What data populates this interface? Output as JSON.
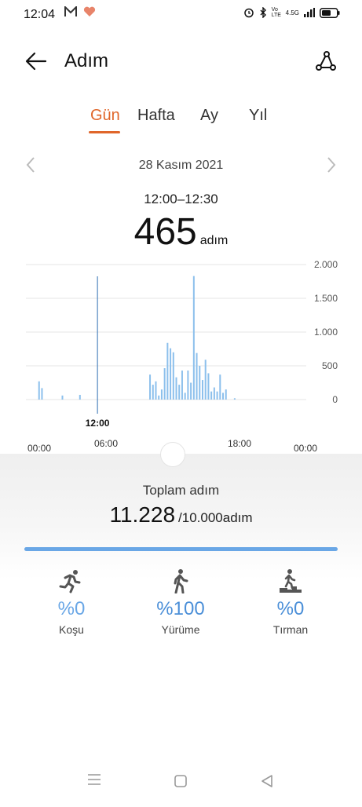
{
  "status_bar": {
    "time": "12:04",
    "network": "4.5G",
    "volte": "Vo LTE"
  },
  "header": {
    "title": "Adım"
  },
  "tabs": [
    {
      "label": "Gün",
      "active": true
    },
    {
      "label": "Hafta",
      "active": false
    },
    {
      "label": "Ay",
      "active": false
    },
    {
      "label": "Yıl",
      "active": false
    }
  ],
  "date": {
    "label": "28 Kasım 2021",
    "prev_icon": "chevron-left",
    "next_icon": "chevron-right"
  },
  "selection": {
    "time_range": "12:00–12:30",
    "steps": "465",
    "unit": "adım"
  },
  "colors": {
    "accent": "#e0662a",
    "bar": "#8cc0ec",
    "bar_selected": "#2f6fb3",
    "progress": "#6aa7e6"
  },
  "chart_data": {
    "type": "bar",
    "ylim": [
      0,
      2000
    ],
    "y_ticks": [
      "2.000",
      "1.500",
      "1.000",
      "500",
      "0"
    ],
    "x_tick_labels": [
      "00:00",
      "06:00",
      "12:00",
      "18:00",
      "00:00"
    ],
    "selected_x_label": "12:00",
    "selected_index": 24,
    "values": [
      0,
      0,
      0,
      0,
      270,
      170,
      0,
      0,
      0,
      0,
      0,
      0,
      60,
      0,
      0,
      0,
      0,
      0,
      70,
      0,
      0,
      0,
      0,
      0,
      0,
      0,
      0,
      0,
      0,
      0,
      0,
      0,
      0,
      0,
      0,
      0,
      0,
      0,
      0,
      0,
      0,
      0,
      370,
      220,
      270,
      60,
      150,
      465,
      840,
      760,
      700,
      330,
      220,
      430,
      100,
      430,
      250,
      1830,
      690,
      500,
      290,
      590,
      390,
      120,
      180,
      120,
      370,
      100,
      150,
      0,
      0,
      20,
      0,
      0,
      0,
      0,
      0,
      0,
      0,
      0,
      0,
      0,
      0,
      0,
      0,
      0,
      0,
      0,
      0,
      0,
      0,
      0,
      0,
      0,
      0,
      0
    ]
  },
  "summary": {
    "label": "Toplam adım",
    "total": "11.228",
    "goal": "/10.000adım",
    "progress": 1.0
  },
  "activities": [
    {
      "icon": "running-icon",
      "percent": "%0",
      "label": "Koşu"
    },
    {
      "icon": "walking-icon",
      "percent": "%100",
      "label": "Yürüme"
    },
    {
      "icon": "stairs-climb-icon",
      "percent": "%0",
      "label": "Tırman"
    }
  ]
}
